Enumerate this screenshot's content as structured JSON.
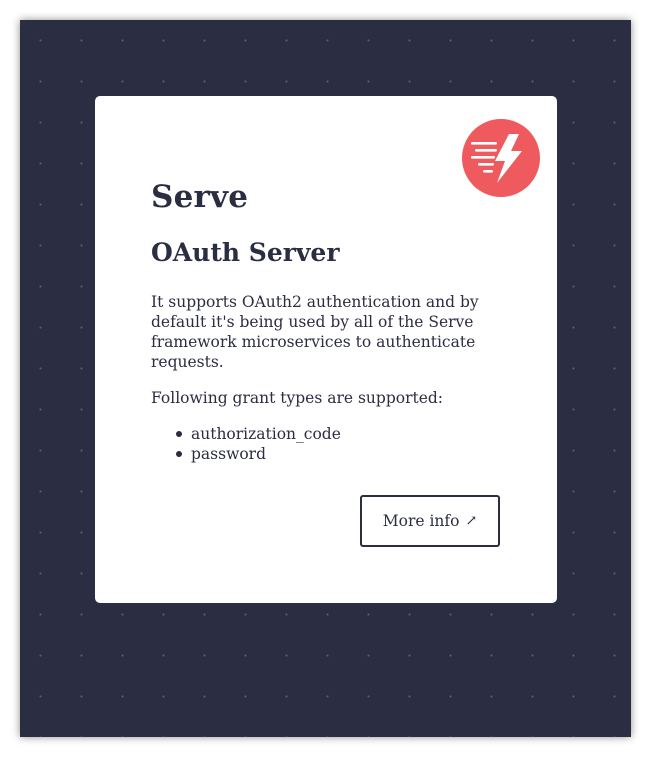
{
  "brand": "Serve",
  "service_title": "OAuth Server",
  "description": "It supports OAuth2 authentication and by default it's being used by all of the Serve framework microservices to authenticate requests.",
  "grant_intro": "Following grant types are supported:",
  "grant_types": [
    "authorization_code",
    "password"
  ],
  "more_info": {
    "label": "More info",
    "icon": "↗"
  },
  "colors": {
    "background": "#2b2d42",
    "card": "#ffffff",
    "text": "#2b2d42",
    "logo": "#ef5a5f"
  },
  "logo_icon": "lightning-bolt-icon"
}
